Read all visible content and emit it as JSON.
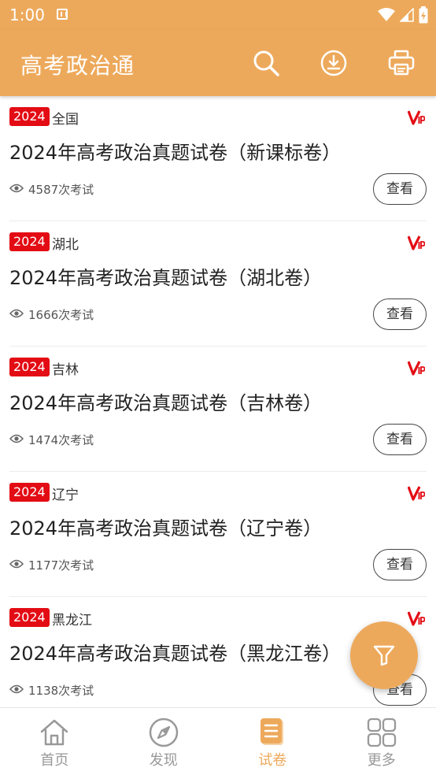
{
  "status": {
    "time": "1:00"
  },
  "app": {
    "title": "高考政治通"
  },
  "colors": {
    "accent": "#EDA95B",
    "badge": "#E30C14"
  },
  "icons": {
    "search": "search-icon",
    "download": "download-icon",
    "print": "print-icon",
    "vip": "vip-icon",
    "eye": "eye-icon",
    "filter": "filter-icon"
  },
  "papers": [
    {
      "year": "2024",
      "region": "全国",
      "title": "2024年高考政治真题试卷（新课标卷）",
      "count": "4587次考试",
      "button": "查看"
    },
    {
      "year": "2024",
      "region": "湖北",
      "title": "2024年高考政治真题试卷（湖北卷）",
      "count": "1666次考试",
      "button": "查看"
    },
    {
      "year": "2024",
      "region": "吉林",
      "title": "2024年高考政治真题试卷（吉林卷）",
      "count": "1474次考试",
      "button": "查看"
    },
    {
      "year": "2024",
      "region": "辽宁",
      "title": "2024年高考政治真题试卷（辽宁卷）",
      "count": "1177次考试",
      "button": "查看"
    },
    {
      "year": "2024",
      "region": "黑龙江",
      "title": "2024年高考政治真题试卷（黑龙江卷）",
      "count": "1138次考试",
      "button": "查看"
    }
  ],
  "nav": [
    {
      "label": "首页",
      "icon": "home-icon",
      "active": false
    },
    {
      "label": "发现",
      "icon": "compass-icon",
      "active": false
    },
    {
      "label": "试卷",
      "icon": "paper-icon",
      "active": true
    },
    {
      "label": "更多",
      "icon": "grid-icon",
      "active": false
    }
  ]
}
